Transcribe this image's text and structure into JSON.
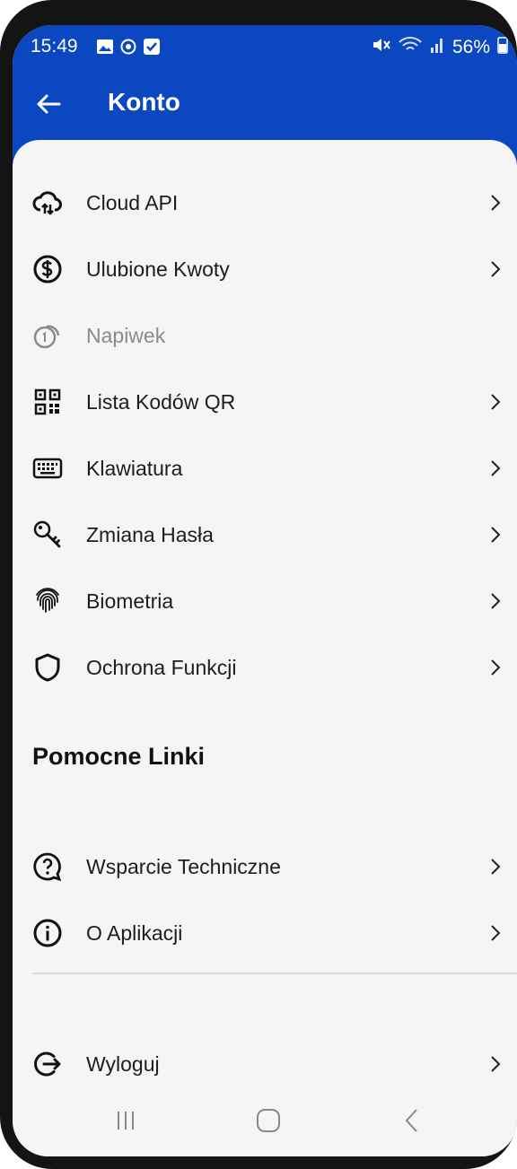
{
  "status_bar": {
    "time": "15:49",
    "battery": "56%",
    "left_icons": [
      "gallery-icon",
      "sync-icon",
      "checkbox-icon"
    ],
    "right_icons": [
      "mute-icon",
      "wifi-icon",
      "signal-icon",
      "battery-icon"
    ]
  },
  "header": {
    "title": "Konto",
    "back_icon": "arrow-left-icon",
    "background_color": "#0b47c0"
  },
  "account_items": [
    {
      "label": "Cloud API",
      "icon": "cloud-sync-icon",
      "enabled": true
    },
    {
      "label": "Ulubione Kwoty",
      "icon": "dollar-circle-icon",
      "enabled": true
    },
    {
      "label": "Napiwek",
      "icon": "tip-coin-icon",
      "enabled": false
    },
    {
      "label": "Lista Kodów QR",
      "icon": "qr-code-icon",
      "enabled": true
    },
    {
      "label": "Klawiatura",
      "icon": "keyboard-icon",
      "enabled": true
    },
    {
      "label": "Zmiana Hasła",
      "icon": "key-icon",
      "enabled": true
    },
    {
      "label": "Biometria",
      "icon": "fingerprint-icon",
      "enabled": true
    },
    {
      "label": "Ochrona Funkcji",
      "icon": "shield-icon",
      "enabled": true
    }
  ],
  "helpful_links": {
    "title": "Pomocne Linki",
    "items": [
      {
        "label": "Wsparcie Techniczne",
        "icon": "help-bubble-icon"
      },
      {
        "label": "O Aplikacji",
        "icon": "info-circle-icon"
      }
    ]
  },
  "logout": {
    "label": "Wyloguj",
    "icon": "logout-icon"
  },
  "nav_bar": {
    "buttons": [
      "recents-icon",
      "home-icon",
      "back-icon"
    ]
  }
}
